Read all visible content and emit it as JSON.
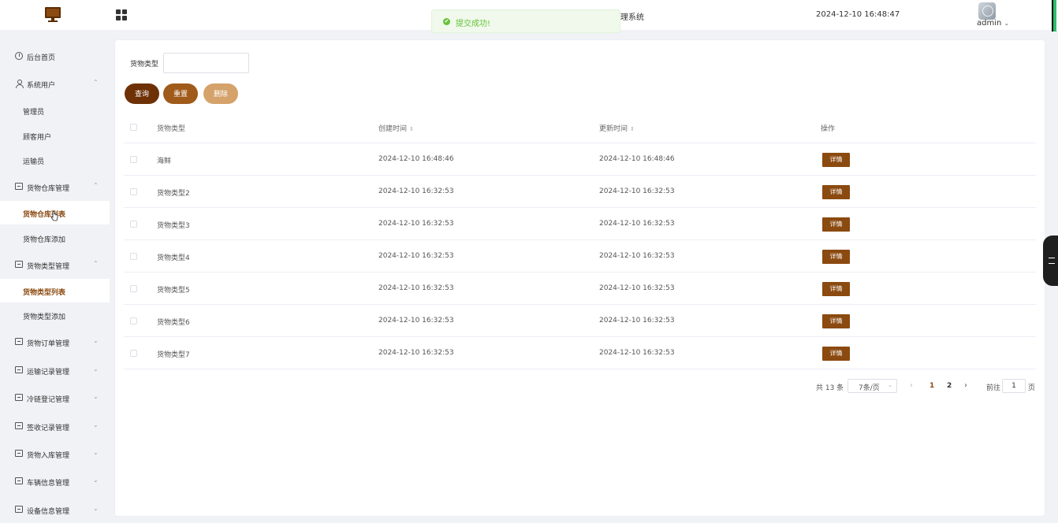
{
  "header": {
    "title_partial": "理系统",
    "datetime": "2024-12-10 16:48:47",
    "user": "admin",
    "user_arrow": "⌄"
  },
  "toast": {
    "icon": "✔",
    "text": "提交成功!"
  },
  "sidebar": {
    "items": [
      {
        "label": "后台首页",
        "icon": "clock-icon"
      },
      {
        "label": "系统用户",
        "icon": "user-icon",
        "arrow": "⌃"
      },
      {
        "label": "管理员"
      },
      {
        "label": "顾客用户"
      },
      {
        "label": "运输员"
      },
      {
        "label": "货物仓库管理",
        "icon": "box-icon",
        "arrow": "⌃"
      },
      {
        "label": "货物仓库列表"
      },
      {
        "label": "货物仓库添加"
      },
      {
        "label": "货物类型管理",
        "icon": "box-icon",
        "arrow": "⌃"
      },
      {
        "label": "货物类型列表"
      },
      {
        "label": "货物类型添加"
      },
      {
        "label": "货物订单管理",
        "icon": "box-icon",
        "arrow": "⌄"
      },
      {
        "label": "运输记录管理",
        "icon": "box-icon",
        "arrow": "⌄"
      },
      {
        "label": "冷链登记管理",
        "icon": "box-icon",
        "arrow": "⌄"
      },
      {
        "label": "签收记录管理",
        "icon": "box-icon",
        "arrow": "⌄"
      },
      {
        "label": "货物入库管理",
        "icon": "box-icon",
        "arrow": "⌄"
      },
      {
        "label": "车辆信息管理",
        "icon": "box-icon",
        "arrow": "⌄"
      },
      {
        "label": "设备信息管理",
        "icon": "box-icon",
        "arrow": "⌄"
      }
    ]
  },
  "filter": {
    "label": "货物类型",
    "value": "",
    "placeholder": ""
  },
  "buttons": {
    "query": "查询",
    "reset": "重置",
    "delete": "删除"
  },
  "table": {
    "columns": [
      "货物类型",
      "创建时间",
      "更新时间",
      "操作"
    ],
    "sort_icon": "⇕",
    "detail_label": "详情",
    "rows": [
      {
        "type": "海鲜",
        "created": "2024-12-10 16:48:46",
        "updated": "2024-12-10 16:48:46"
      },
      {
        "type": "货物类型2",
        "created": "2024-12-10 16:32:53",
        "updated": "2024-12-10 16:32:53"
      },
      {
        "type": "货物类型3",
        "created": "2024-12-10 16:32:53",
        "updated": "2024-12-10 16:32:53"
      },
      {
        "type": "货物类型4",
        "created": "2024-12-10 16:32:53",
        "updated": "2024-12-10 16:32:53"
      },
      {
        "type": "货物类型5",
        "created": "2024-12-10 16:32:53",
        "updated": "2024-12-10 16:32:53"
      },
      {
        "type": "货物类型6",
        "created": "2024-12-10 16:32:53",
        "updated": "2024-12-10 16:32:53"
      },
      {
        "type": "货物类型7",
        "created": "2024-12-10 16:32:53",
        "updated": "2024-12-10 16:32:53"
      }
    ]
  },
  "pagination": {
    "total": "共 13 条",
    "page_size": "7条/页",
    "size_arrow": "⌄",
    "prev": "‹",
    "pages": [
      "1",
      "2"
    ],
    "next": "›",
    "goto_label": "前往",
    "goto_value": "1",
    "page_suffix": "页"
  },
  "colors": {
    "accent": "#8b4a10",
    "query": "#6e3106",
    "reset": "#a05a19",
    "delete": "#d4a26a",
    "success": "#67c23a"
  }
}
